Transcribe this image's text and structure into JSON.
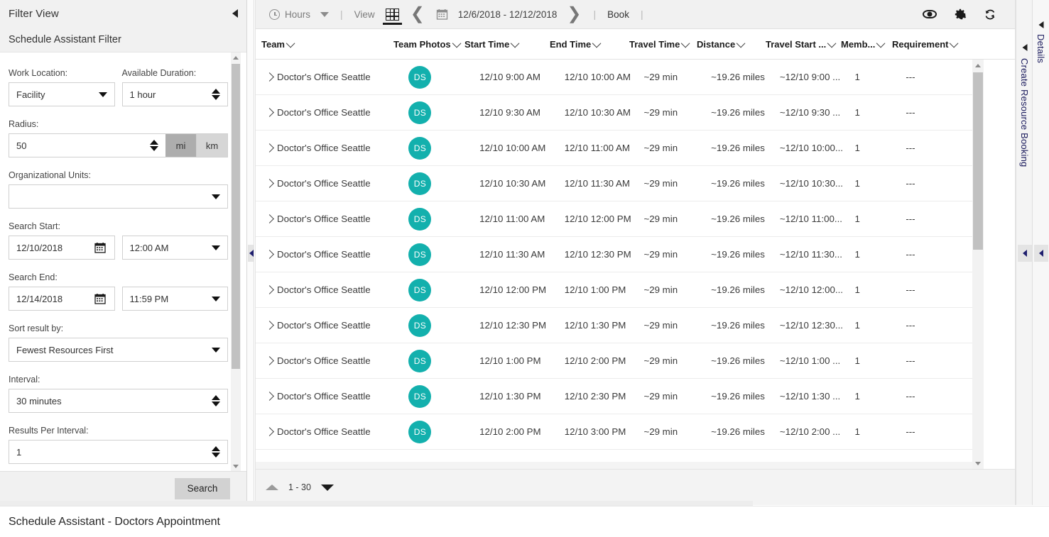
{
  "filter_panel": {
    "header_title": "Filter View",
    "collapse_icon": "collapse-left-arrow-icon",
    "subheader_title": "Schedule Assistant Filter",
    "work_location": {
      "label": "Work Location:",
      "value": "Facility"
    },
    "available_duration": {
      "label": "Available Duration:",
      "value": "1 hour"
    },
    "radius": {
      "label": "Radius:",
      "value": "50",
      "unit_mi": "mi",
      "unit_km": "km",
      "selected_unit": "mi"
    },
    "organizational_units": {
      "label": "Organizational Units:",
      "value": ""
    },
    "search_start": {
      "label": "Search Start:",
      "date": "12/10/2018",
      "time": "12:00 AM"
    },
    "search_end": {
      "label": "Search End:",
      "date": "12/14/2018",
      "time": "11:59 PM"
    },
    "sort_result_by": {
      "label": "Sort result by:",
      "value": "Fewest Resources First"
    },
    "interval": {
      "label": "Interval:",
      "value": "30 minutes"
    },
    "results_per_interval": {
      "label": "Results Per Interval:",
      "value": "1"
    },
    "search_button": "Search"
  },
  "toolbar": {
    "hours_label": "Hours",
    "clock_icon": "clock-icon",
    "hours_caret": "chevron-down-icon",
    "separator": "|",
    "view_label": "View",
    "grid_view_icon": "grid-view-icon",
    "prev_icon": "chevron-left-icon",
    "calendar_icon": "calendar-icon",
    "date_range": "12/6/2018 - 12/12/2018",
    "next_icon": "chevron-right-icon",
    "separator2": "|",
    "book_label": "Book",
    "separator3": "|",
    "eye_icon": "eye-icon",
    "gear_icon": "gear-icon",
    "refresh_icon": "refresh-icon"
  },
  "grid": {
    "columns": [
      {
        "key": "team",
        "label": "Team"
      },
      {
        "key": "team_photos",
        "label": "Team Photos"
      },
      {
        "key": "start_time",
        "label": "Start Time"
      },
      {
        "key": "end_time",
        "label": "End Time"
      },
      {
        "key": "travel_time",
        "label": "Travel Time"
      },
      {
        "key": "distance",
        "label": "Distance"
      },
      {
        "key": "travel_start",
        "label": "Travel Start ..."
      },
      {
        "key": "members",
        "label": "Memb..."
      },
      {
        "key": "requirement",
        "label": "Requirement"
      }
    ],
    "rows": [
      {
        "team": "Doctor's Office Seattle",
        "initials": "DS",
        "start_time": "12/10 9:00 AM",
        "end_time": "12/10 10:00 AM",
        "travel_time": "~29 min",
        "distance": "~19.26 miles",
        "travel_start": "~12/10 9:00 ...",
        "members": "1",
        "requirement": "---"
      },
      {
        "team": "Doctor's Office Seattle",
        "initials": "DS",
        "start_time": "12/10 9:30 AM",
        "end_time": "12/10 10:30 AM",
        "travel_time": "~29 min",
        "distance": "~19.26 miles",
        "travel_start": "~12/10 9:30 ...",
        "members": "1",
        "requirement": "---"
      },
      {
        "team": "Doctor's Office Seattle",
        "initials": "DS",
        "start_time": "12/10 10:00 AM",
        "end_time": "12/10 11:00 AM",
        "travel_time": "~29 min",
        "distance": "~19.26 miles",
        "travel_start": "~12/10 10:00...",
        "members": "1",
        "requirement": "---"
      },
      {
        "team": "Doctor's Office Seattle",
        "initials": "DS",
        "start_time": "12/10 10:30 AM",
        "end_time": "12/10 11:30 AM",
        "travel_time": "~29 min",
        "distance": "~19.26 miles",
        "travel_start": "~12/10 10:30...",
        "members": "1",
        "requirement": "---"
      },
      {
        "team": "Doctor's Office Seattle",
        "initials": "DS",
        "start_time": "12/10 11:00 AM",
        "end_time": "12/10 12:00 PM",
        "travel_time": "~29 min",
        "distance": "~19.26 miles",
        "travel_start": "~12/10 11:00...",
        "members": "1",
        "requirement": "---"
      },
      {
        "team": "Doctor's Office Seattle",
        "initials": "DS",
        "start_time": "12/10 11:30 AM",
        "end_time": "12/10 12:30 PM",
        "travel_time": "~29 min",
        "distance": "~19.26 miles",
        "travel_start": "~12/10 11:30...",
        "members": "1",
        "requirement": "---"
      },
      {
        "team": "Doctor's Office Seattle",
        "initials": "DS",
        "start_time": "12/10 12:00 PM",
        "end_time": "12/10 1:00 PM",
        "travel_time": "~29 min",
        "distance": "~19.26 miles",
        "travel_start": "~12/10 12:00...",
        "members": "1",
        "requirement": "---"
      },
      {
        "team": "Doctor's Office Seattle",
        "initials": "DS",
        "start_time": "12/10 12:30 PM",
        "end_time": "12/10 1:30 PM",
        "travel_time": "~29 min",
        "distance": "~19.26 miles",
        "travel_start": "~12/10 12:30...",
        "members": "1",
        "requirement": "---"
      },
      {
        "team": "Doctor's Office Seattle",
        "initials": "DS",
        "start_time": "12/10 1:00 PM",
        "end_time": "12/10 2:00 PM",
        "travel_time": "~29 min",
        "distance": "~19.26 miles",
        "travel_start": "~12/10 1:00 ...",
        "members": "1",
        "requirement": "---"
      },
      {
        "team": "Doctor's Office Seattle",
        "initials": "DS",
        "start_time": "12/10 1:30 PM",
        "end_time": "12/10 2:30 PM",
        "travel_time": "~29 min",
        "distance": "~19.26 miles",
        "travel_start": "~12/10 1:30 ...",
        "members": "1",
        "requirement": "---"
      },
      {
        "team": "Doctor's Office Seattle",
        "initials": "DS",
        "start_time": "12/10 2:00 PM",
        "end_time": "12/10 3:00 PM",
        "travel_time": "~29 min",
        "distance": "~19.26 miles",
        "travel_start": "~12/10 2:00 ...",
        "members": "1",
        "requirement": "---"
      }
    ]
  },
  "pager": {
    "up_icon": "chevron-up-icon",
    "range_label": "1 - 30",
    "down_icon": "chevron-down-icon"
  },
  "rails": {
    "create_resource_booking": "Create Resource Booking",
    "details": "Details"
  },
  "statusbar": {
    "title": "Schedule Assistant - Doctors Appointment"
  },
  "colors": {
    "accent_teal": "#13b0ad",
    "panel_gray": "#f1f1f1",
    "link_navy": "#1a1a5c"
  }
}
